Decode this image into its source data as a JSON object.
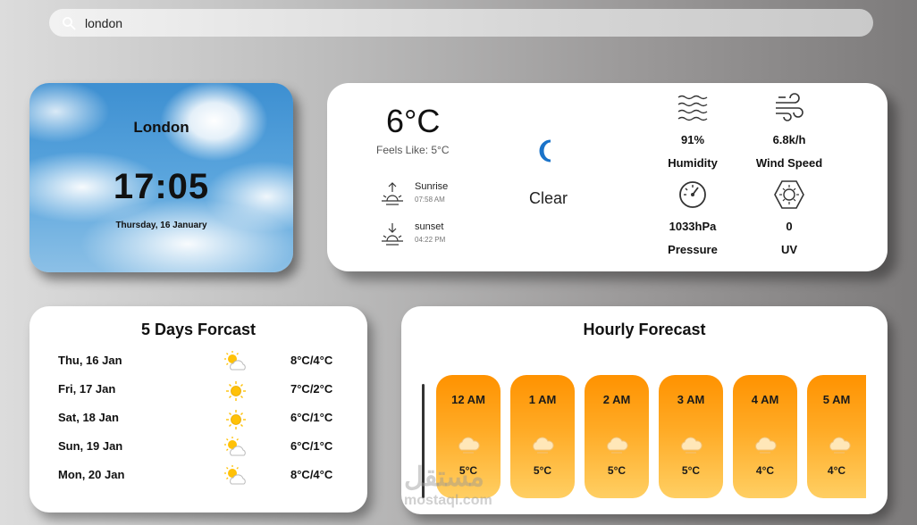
{
  "search": {
    "value": "london",
    "icon": "search-icon"
  },
  "city_card": {
    "city": "London",
    "time": "17:05",
    "date": "Thursday, 16 January"
  },
  "current": {
    "temp": "6°C",
    "feels_like": "Feels Like: 5°C",
    "sunrise_label": "Sunrise",
    "sunrise_time": "07:58 AM",
    "sunset_label": "sunset",
    "sunset_time": "04:22 PM",
    "condition": "Clear",
    "condition_icon": "moon-icon",
    "accent": "#1a73c9",
    "stats": [
      {
        "value": "91%",
        "label": "Humidity",
        "icon": "waves-icon"
      },
      {
        "value": "6.8k/h",
        "label": "Wind Speed",
        "icon": "wind-icon"
      },
      {
        "value": "1033hPa",
        "label": "Pressure",
        "icon": "gauge-icon"
      },
      {
        "value": "0",
        "label": "UV",
        "icon": "uv-icon"
      }
    ]
  },
  "days": {
    "title": "5 Days Forcast",
    "items": [
      {
        "day": "Thu, 16 Jan",
        "range": "8°C/4°C",
        "icon": "partly-cloudy-icon"
      },
      {
        "day": "Fri, 17 Jan",
        "range": "7°C/2°C",
        "icon": "sun-icon"
      },
      {
        "day": "Sat, 18 Jan",
        "range": "6°C/1°C",
        "icon": "sun-icon"
      },
      {
        "day": "Sun, 19 Jan",
        "range": "6°C/1°C",
        "icon": "partly-cloudy-icon"
      },
      {
        "day": "Mon, 20 Jan",
        "range": "8°C/4°C",
        "icon": "partly-cloudy-icon"
      }
    ]
  },
  "hourly": {
    "title": "Hourly Forecast",
    "items": [
      {
        "hour": "12 AM",
        "temp": "5°C",
        "icon": "cloud-icon"
      },
      {
        "hour": "1 AM",
        "temp": "5°C",
        "icon": "cloud-icon"
      },
      {
        "hour": "2 AM",
        "temp": "5°C",
        "icon": "cloud-icon"
      },
      {
        "hour": "3 AM",
        "temp": "5°C",
        "icon": "cloud-icon"
      },
      {
        "hour": "4 AM",
        "temp": "4°C",
        "icon": "cloud-icon"
      },
      {
        "hour": "5 AM",
        "temp": "4°C",
        "icon": "cloud-icon"
      }
    ]
  },
  "watermark": {
    "arabic": "مستقل",
    "latin": "mostaql.com"
  }
}
